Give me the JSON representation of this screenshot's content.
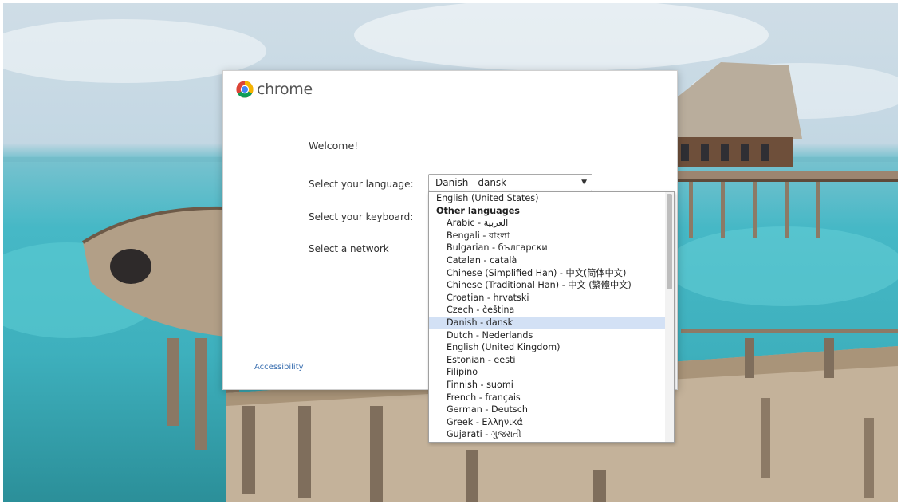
{
  "brand": {
    "name": "chrome",
    "icon": "chrome-logo-icon"
  },
  "welcome": "Welcome!",
  "labels": {
    "language": "Select your language:",
    "keyboard": "Select your keyboard:",
    "network": "Select a network"
  },
  "language_select": {
    "value": "Danish - dansk",
    "icon": "dropdown-caret-icon"
  },
  "language_list": {
    "default": "English (United States)",
    "group_label": "Other languages",
    "items": [
      "Arabic - العربية",
      "Bengali - বাংলা",
      "Bulgarian - български",
      "Catalan - català",
      "Chinese (Simplified Han) - 中文(简体中文)",
      "Chinese (Traditional Han) - 中文 (繁體中文)",
      "Croatian - hrvatski",
      "Czech - čeština",
      "Danish - dansk",
      "Dutch - Nederlands",
      "English (United Kingdom)",
      "Estonian - eesti",
      "Filipino",
      "Finnish - suomi",
      "French - français",
      "German - Deutsch",
      "Greek - Ελληνικά",
      "Gujarati - ગુજરાતી"
    ],
    "selected": "Danish - dansk"
  },
  "accessibility": "Accessibility",
  "colors": {
    "link": "#3a6fb0",
    "selection": "#d3e1f5"
  }
}
